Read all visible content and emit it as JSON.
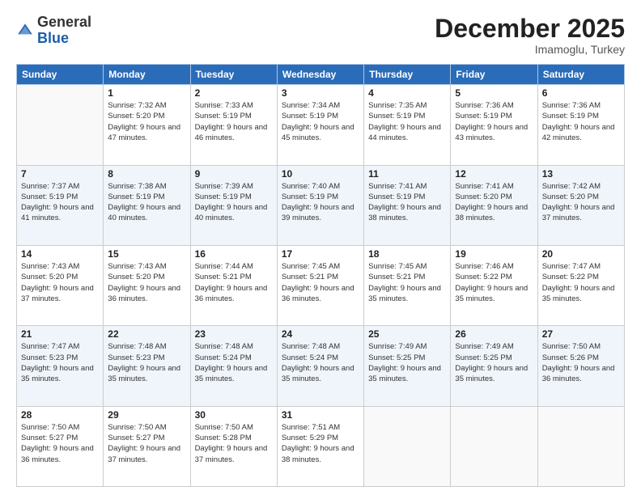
{
  "header": {
    "logo_general": "General",
    "logo_blue": "Blue",
    "month": "December 2025",
    "location": "Imamoglu, Turkey"
  },
  "weekdays": [
    "Sunday",
    "Monday",
    "Tuesday",
    "Wednesday",
    "Thursday",
    "Friday",
    "Saturday"
  ],
  "weeks": [
    [
      {
        "day": "",
        "sunrise": "",
        "sunset": "",
        "daylight": ""
      },
      {
        "day": "1",
        "sunrise": "Sunrise: 7:32 AM",
        "sunset": "Sunset: 5:20 PM",
        "daylight": "Daylight: 9 hours and 47 minutes."
      },
      {
        "day": "2",
        "sunrise": "Sunrise: 7:33 AM",
        "sunset": "Sunset: 5:19 PM",
        "daylight": "Daylight: 9 hours and 46 minutes."
      },
      {
        "day": "3",
        "sunrise": "Sunrise: 7:34 AM",
        "sunset": "Sunset: 5:19 PM",
        "daylight": "Daylight: 9 hours and 45 minutes."
      },
      {
        "day": "4",
        "sunrise": "Sunrise: 7:35 AM",
        "sunset": "Sunset: 5:19 PM",
        "daylight": "Daylight: 9 hours and 44 minutes."
      },
      {
        "day": "5",
        "sunrise": "Sunrise: 7:36 AM",
        "sunset": "Sunset: 5:19 PM",
        "daylight": "Daylight: 9 hours and 43 minutes."
      },
      {
        "day": "6",
        "sunrise": "Sunrise: 7:36 AM",
        "sunset": "Sunset: 5:19 PM",
        "daylight": "Daylight: 9 hours and 42 minutes."
      }
    ],
    [
      {
        "day": "7",
        "sunrise": "Sunrise: 7:37 AM",
        "sunset": "Sunset: 5:19 PM",
        "daylight": "Daylight: 9 hours and 41 minutes."
      },
      {
        "day": "8",
        "sunrise": "Sunrise: 7:38 AM",
        "sunset": "Sunset: 5:19 PM",
        "daylight": "Daylight: 9 hours and 40 minutes."
      },
      {
        "day": "9",
        "sunrise": "Sunrise: 7:39 AM",
        "sunset": "Sunset: 5:19 PM",
        "daylight": "Daylight: 9 hours and 40 minutes."
      },
      {
        "day": "10",
        "sunrise": "Sunrise: 7:40 AM",
        "sunset": "Sunset: 5:19 PM",
        "daylight": "Daylight: 9 hours and 39 minutes."
      },
      {
        "day": "11",
        "sunrise": "Sunrise: 7:41 AM",
        "sunset": "Sunset: 5:19 PM",
        "daylight": "Daylight: 9 hours and 38 minutes."
      },
      {
        "day": "12",
        "sunrise": "Sunrise: 7:41 AM",
        "sunset": "Sunset: 5:20 PM",
        "daylight": "Daylight: 9 hours and 38 minutes."
      },
      {
        "day": "13",
        "sunrise": "Sunrise: 7:42 AM",
        "sunset": "Sunset: 5:20 PM",
        "daylight": "Daylight: 9 hours and 37 minutes."
      }
    ],
    [
      {
        "day": "14",
        "sunrise": "Sunrise: 7:43 AM",
        "sunset": "Sunset: 5:20 PM",
        "daylight": "Daylight: 9 hours and 37 minutes."
      },
      {
        "day": "15",
        "sunrise": "Sunrise: 7:43 AM",
        "sunset": "Sunset: 5:20 PM",
        "daylight": "Daylight: 9 hours and 36 minutes."
      },
      {
        "day": "16",
        "sunrise": "Sunrise: 7:44 AM",
        "sunset": "Sunset: 5:21 PM",
        "daylight": "Daylight: 9 hours and 36 minutes."
      },
      {
        "day": "17",
        "sunrise": "Sunrise: 7:45 AM",
        "sunset": "Sunset: 5:21 PM",
        "daylight": "Daylight: 9 hours and 36 minutes."
      },
      {
        "day": "18",
        "sunrise": "Sunrise: 7:45 AM",
        "sunset": "Sunset: 5:21 PM",
        "daylight": "Daylight: 9 hours and 35 minutes."
      },
      {
        "day": "19",
        "sunrise": "Sunrise: 7:46 AM",
        "sunset": "Sunset: 5:22 PM",
        "daylight": "Daylight: 9 hours and 35 minutes."
      },
      {
        "day": "20",
        "sunrise": "Sunrise: 7:47 AM",
        "sunset": "Sunset: 5:22 PM",
        "daylight": "Daylight: 9 hours and 35 minutes."
      }
    ],
    [
      {
        "day": "21",
        "sunrise": "Sunrise: 7:47 AM",
        "sunset": "Sunset: 5:23 PM",
        "daylight": "Daylight: 9 hours and 35 minutes."
      },
      {
        "day": "22",
        "sunrise": "Sunrise: 7:48 AM",
        "sunset": "Sunset: 5:23 PM",
        "daylight": "Daylight: 9 hours and 35 minutes."
      },
      {
        "day": "23",
        "sunrise": "Sunrise: 7:48 AM",
        "sunset": "Sunset: 5:24 PM",
        "daylight": "Daylight: 9 hours and 35 minutes."
      },
      {
        "day": "24",
        "sunrise": "Sunrise: 7:48 AM",
        "sunset": "Sunset: 5:24 PM",
        "daylight": "Daylight: 9 hours and 35 minutes."
      },
      {
        "day": "25",
        "sunrise": "Sunrise: 7:49 AM",
        "sunset": "Sunset: 5:25 PM",
        "daylight": "Daylight: 9 hours and 35 minutes."
      },
      {
        "day": "26",
        "sunrise": "Sunrise: 7:49 AM",
        "sunset": "Sunset: 5:25 PM",
        "daylight": "Daylight: 9 hours and 35 minutes."
      },
      {
        "day": "27",
        "sunrise": "Sunrise: 7:50 AM",
        "sunset": "Sunset: 5:26 PM",
        "daylight": "Daylight: 9 hours and 36 minutes."
      }
    ],
    [
      {
        "day": "28",
        "sunrise": "Sunrise: 7:50 AM",
        "sunset": "Sunset: 5:27 PM",
        "daylight": "Daylight: 9 hours and 36 minutes."
      },
      {
        "day": "29",
        "sunrise": "Sunrise: 7:50 AM",
        "sunset": "Sunset: 5:27 PM",
        "daylight": "Daylight: 9 hours and 37 minutes."
      },
      {
        "day": "30",
        "sunrise": "Sunrise: 7:50 AM",
        "sunset": "Sunset: 5:28 PM",
        "daylight": "Daylight: 9 hours and 37 minutes."
      },
      {
        "day": "31",
        "sunrise": "Sunrise: 7:51 AM",
        "sunset": "Sunset: 5:29 PM",
        "daylight": "Daylight: 9 hours and 38 minutes."
      },
      {
        "day": "",
        "sunrise": "",
        "sunset": "",
        "daylight": ""
      },
      {
        "day": "",
        "sunrise": "",
        "sunset": "",
        "daylight": ""
      },
      {
        "day": "",
        "sunrise": "",
        "sunset": "",
        "daylight": ""
      }
    ]
  ]
}
